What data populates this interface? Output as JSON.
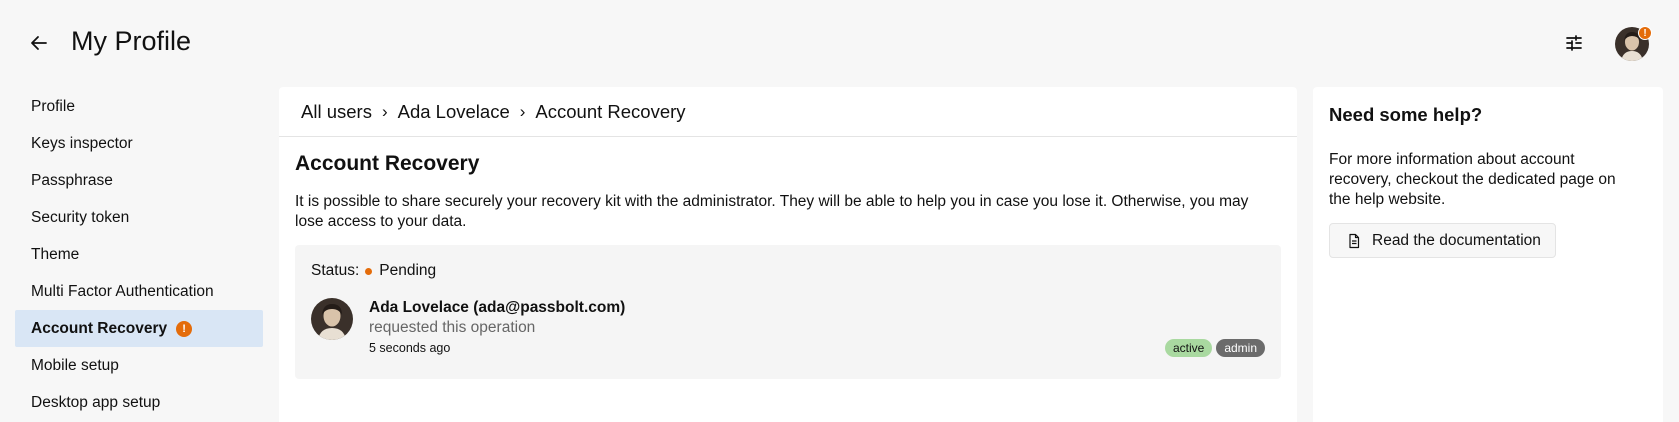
{
  "header": {
    "title": "My Profile",
    "back_icon": "arrow-left-icon",
    "filter_icon": "sliders-icon",
    "avatar_badge": "!"
  },
  "sidebar": {
    "items": [
      {
        "label": "Profile"
      },
      {
        "label": "Keys inspector"
      },
      {
        "label": "Passphrase"
      },
      {
        "label": "Security token"
      },
      {
        "label": "Theme"
      },
      {
        "label": "Multi Factor Authentication"
      },
      {
        "label": "Account Recovery",
        "selected": true,
        "badge": "!"
      },
      {
        "label": "Mobile setup"
      },
      {
        "label": "Desktop app setup"
      }
    ]
  },
  "breadcrumb": {
    "items": [
      "All users",
      "Ada Lovelace",
      "Account Recovery"
    ],
    "separator": "›"
  },
  "main": {
    "title": "Account Recovery",
    "description": "It is possible to share securely your recovery kit with the administrator. They will be able to help you in case you lose it. Otherwise, you may lose access to your data.",
    "status": {
      "label": "Status:",
      "value": "Pending",
      "color": "#e46c0a"
    },
    "request": {
      "name": "Ada Lovelace (ada@passbolt.com)",
      "action": "requested this operation",
      "time": "5 seconds ago",
      "tags": [
        "active",
        "admin"
      ]
    }
  },
  "help": {
    "title": "Need some help?",
    "text": "For more information about account recovery, checkout the dedicated page on the help website.",
    "button_label": "Read the documentation",
    "button_icon": "document-icon"
  },
  "colors": {
    "accent_warning": "#e46c0a",
    "selected_bg": "#d9e6f5",
    "tag_active": "#a9d9a0",
    "tag_admin": "#6b6b6b"
  }
}
